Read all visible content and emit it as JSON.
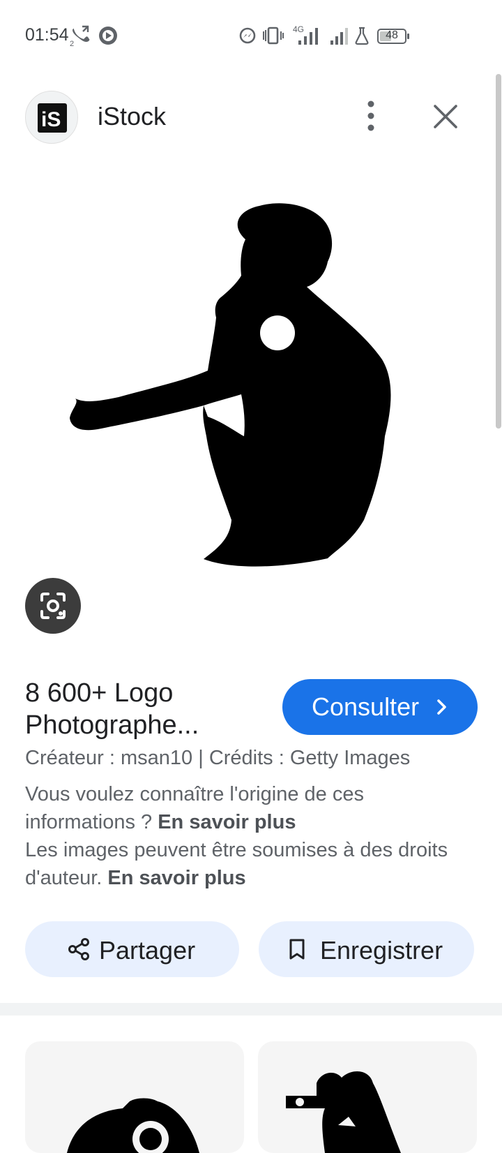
{
  "status_bar": {
    "time": "01:54",
    "call_sim": "2",
    "network": "4G",
    "battery": "48",
    "battery_level": 0.48
  },
  "header": {
    "site_name": "iStock",
    "logo_text": "iS"
  },
  "result": {
    "title_line1": "8 600+ Logo",
    "title_line2": "Photographe...",
    "visit_label": "Consulter",
    "credits": "Créateur : msan10 | Crédits : Getty Images",
    "origin_question": "Vous voulez connaître l'origine de ces informations ?",
    "learn_more_1": "En savoir plus",
    "rights_text": "Les images peuvent être soumises à des droits d'auteur.",
    "learn_more_2": "En savoir plus"
  },
  "actions": {
    "share_label": "Partager",
    "save_label": "Enregistrer"
  },
  "icons": {
    "menu": "more-vert-icon",
    "close": "close-icon",
    "lens": "lens-search-icon",
    "share": "share-icon",
    "save": "bookmark-icon",
    "chevron": "chevron-right-icon"
  },
  "colors": {
    "accent": "#1a73e8",
    "pill_bg": "#e8f0fe",
    "text_secondary": "#5f6368",
    "lens_bg": "#3c3c3c"
  }
}
